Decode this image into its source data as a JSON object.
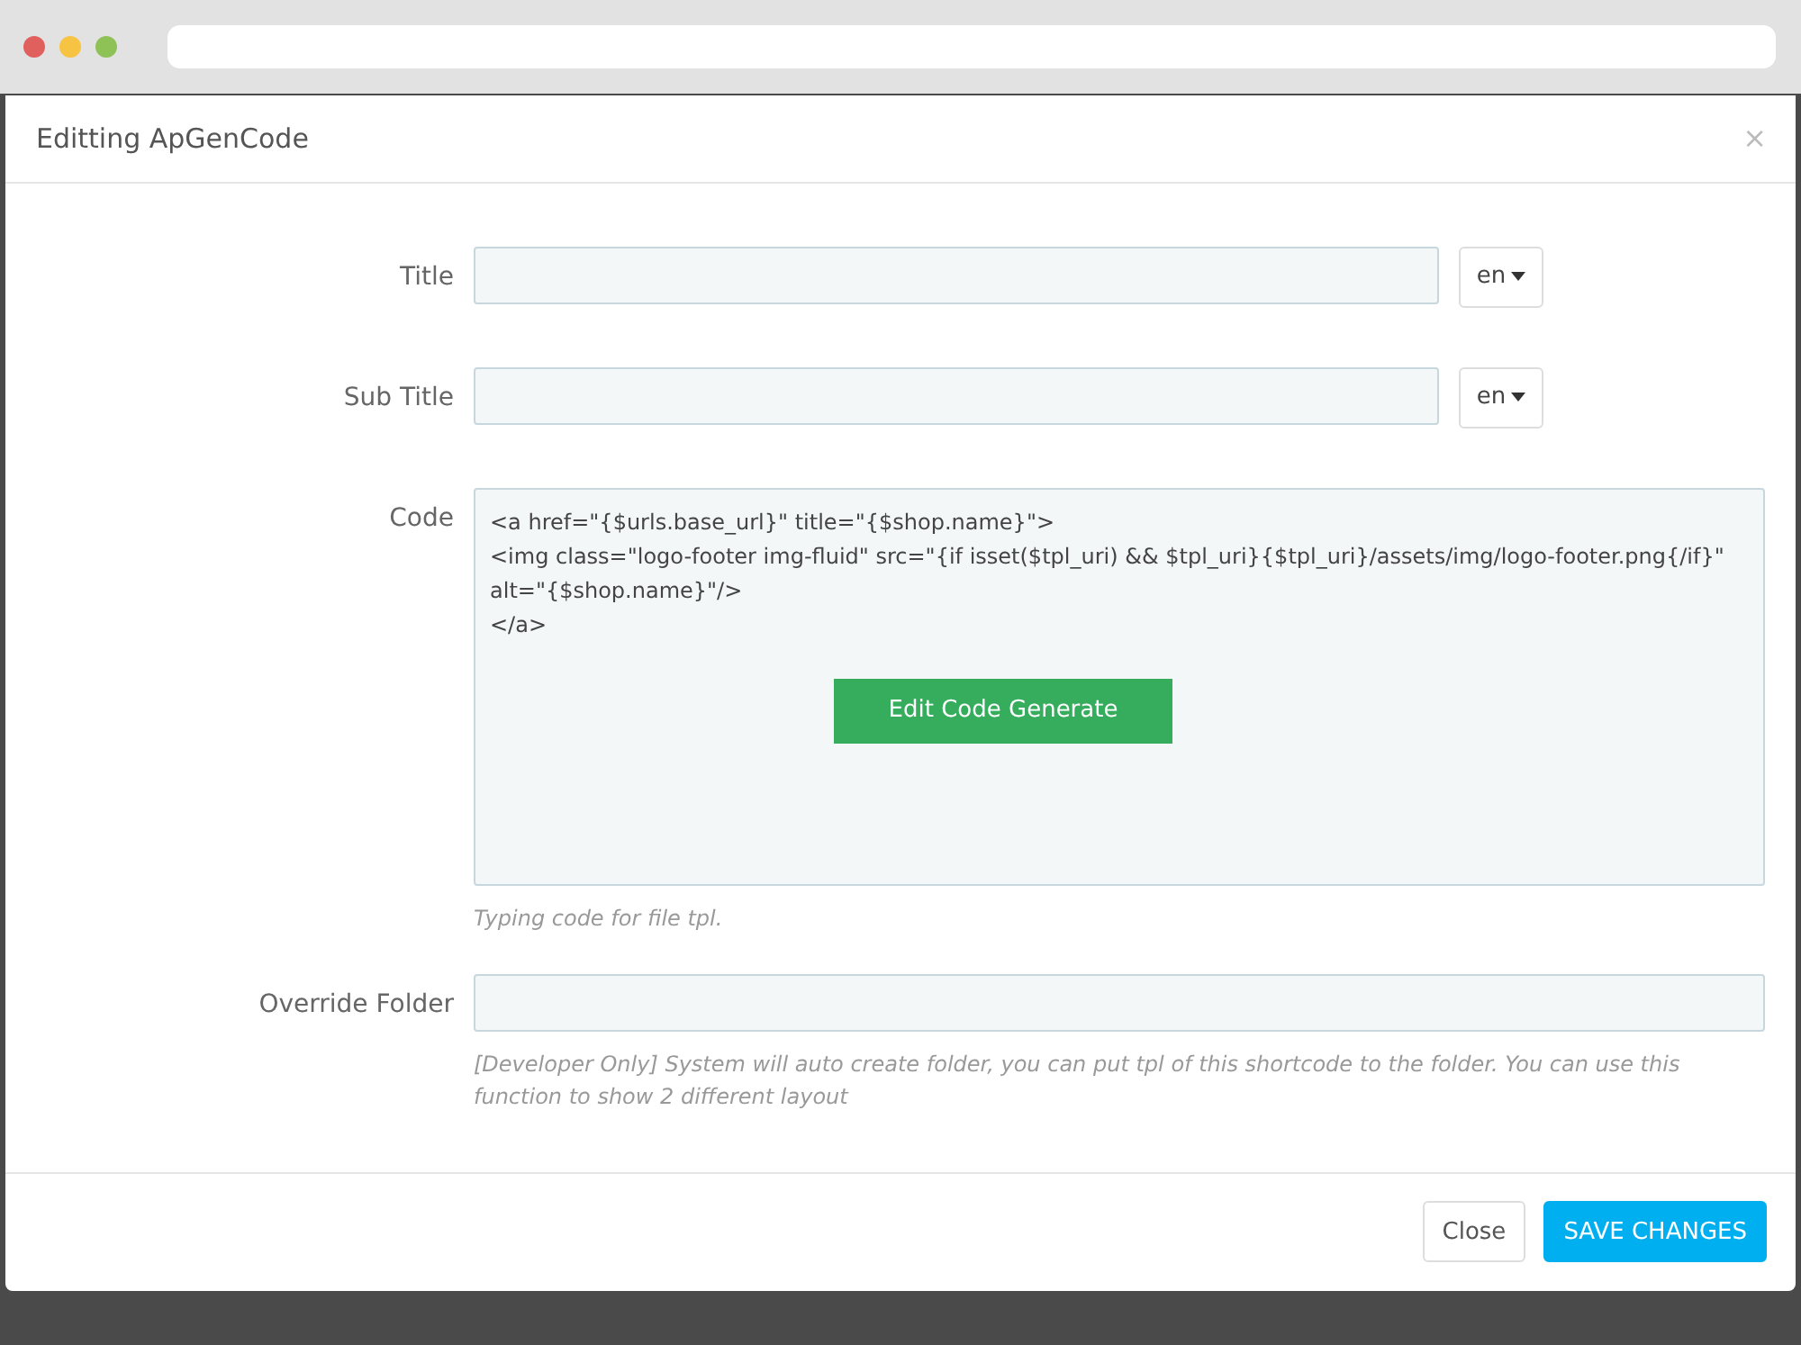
{
  "modal": {
    "title": "Editting ApGenCode",
    "close_icon": "×"
  },
  "fields": [
    {
      "kind": "text",
      "label": "Title",
      "language": "en"
    },
    {
      "kind": "text",
      "label": "Sub Title",
      "language": "en"
    },
    {
      "kind": "code",
      "label": "Code",
      "lines": [
        "<a href=\"{$urls.base_url}\" title=\"{$shop.name}\">",
        "<img class=\"logo-footer img-fluid\" src=\"{if isset($tpl_uri) && $tpl_uri}{$tpl_uri}/assets/img/logo-footer.png{/if}\"",
        "alt=\"{$shop.name}\"/>",
        "</a>"
      ],
      "button": "Edit Code Generate",
      "help": "Typing code for file tpl."
    },
    {
      "kind": "wide",
      "label": "Override Folder",
      "help": "[Developer Only] System will auto create folder, you can put tpl of this shortcode to the folder. You can use this function to show 2 different layout"
    }
  ],
  "footer": {
    "buttons": [
      {
        "label": "Close",
        "kind": "default"
      },
      {
        "label": "SAVE CHANGES",
        "kind": "primary"
      }
    ]
  }
}
